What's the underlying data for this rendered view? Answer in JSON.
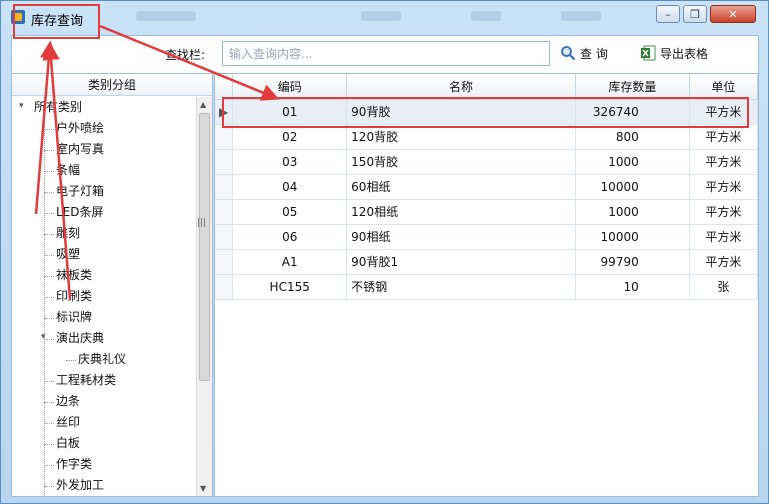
{
  "window": {
    "title": "库存查询",
    "controls": {
      "minimize": "–",
      "restore": "❐",
      "close": "✕"
    }
  },
  "toolbar": {
    "find_label": "查找栏:",
    "search_placeholder": "输入查询内容...",
    "search_value": "",
    "query_label": "查 询",
    "export_label": "导出表格"
  },
  "category": {
    "header": "类别分组",
    "items": [
      {
        "label": "所有类别",
        "level": 0,
        "expanded": true
      },
      {
        "label": "户外喷绘",
        "level": 1
      },
      {
        "label": "室内写真",
        "level": 1
      },
      {
        "label": "条幅",
        "level": 1
      },
      {
        "label": "电子灯箱",
        "level": 1
      },
      {
        "label": "LED条屏",
        "level": 1
      },
      {
        "label": "雕刻",
        "level": 1
      },
      {
        "label": "吸塑",
        "level": 1
      },
      {
        "label": "祙板类",
        "level": 1
      },
      {
        "label": "印刷类",
        "level": 1
      },
      {
        "label": "标识牌",
        "level": 1
      },
      {
        "label": "演出庆典",
        "level": 1,
        "expanded": true
      },
      {
        "label": "庆典礼仪",
        "level": 2
      },
      {
        "label": "工程耗材类",
        "level": 1
      },
      {
        "label": "边条",
        "level": 1
      },
      {
        "label": "丝印",
        "level": 1
      },
      {
        "label": "白板",
        "level": 1
      },
      {
        "label": "作字类",
        "level": 1
      },
      {
        "label": "外发加工",
        "level": 1
      }
    ]
  },
  "grid": {
    "columns": [
      "编码",
      "名称",
      "库存数量",
      "单位"
    ],
    "rows": [
      {
        "code": "01",
        "name": "90背胶",
        "qty": "326740",
        "unit": "平方米"
      },
      {
        "code": "02",
        "name": "120背胶",
        "qty": "800",
        "unit": "平方米"
      },
      {
        "code": "03",
        "name": "150背胶",
        "qty": "1000",
        "unit": "平方米"
      },
      {
        "code": "04",
        "name": "60相纸",
        "qty": "10000",
        "unit": "平方米"
      },
      {
        "code": "05",
        "name": "120相纸",
        "qty": "1000",
        "unit": "平方米"
      },
      {
        "code": "06",
        "name": "90相纸",
        "qty": "10000",
        "unit": "平方米"
      },
      {
        "code": "A1",
        "name": "90背胶1",
        "qty": "99790",
        "unit": "平方米"
      },
      {
        "code": "HC155",
        "name": "不锈钢",
        "qty": "10",
        "unit": "张"
      }
    ],
    "selected_row": 0
  },
  "colors": {
    "annotation": "#e23b3b",
    "frame": "#9cbcdc",
    "window_bg": "#c9e2f6"
  }
}
